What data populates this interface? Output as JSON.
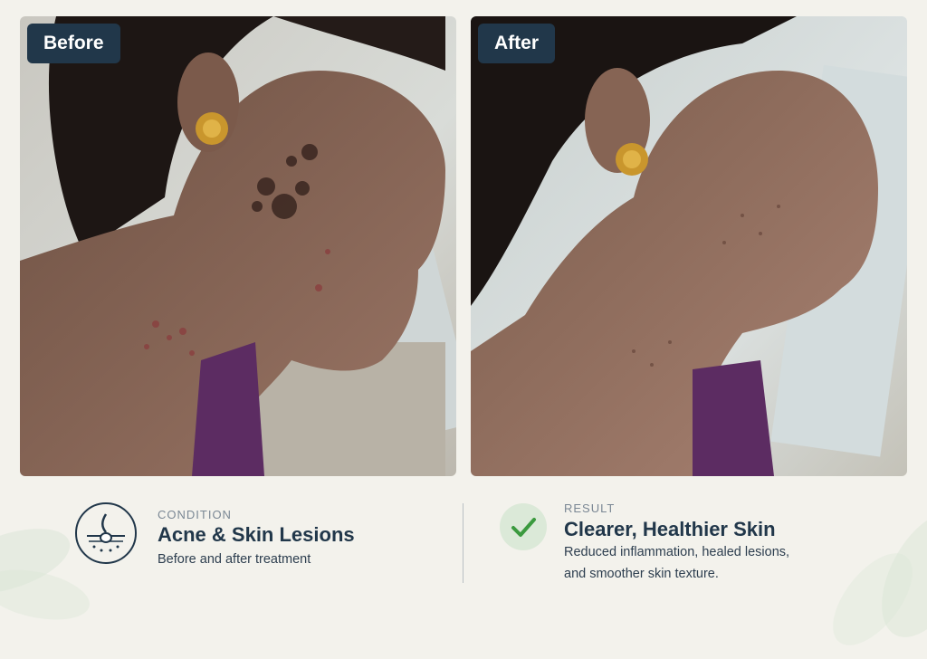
{
  "before_label": "Before",
  "after_label": "After",
  "condition": {
    "kicker": "CONDITION",
    "title": "Acne & Skin Lesions",
    "description": "Before and after treatment"
  },
  "result": {
    "kicker": "RESULT",
    "title": "Clearer, Healthier Skin",
    "description_line1": "Reduced inflammation, healed lesions,",
    "description_line2": "and smoother skin texture."
  },
  "colors": {
    "background": "#f3f2ec",
    "navy": "#21374a",
    "accent_green": "#3b9a3f",
    "check_bg": "#dbe9d8"
  },
  "icons": {
    "condition": "hair-follicle-icon",
    "result": "check-icon"
  }
}
